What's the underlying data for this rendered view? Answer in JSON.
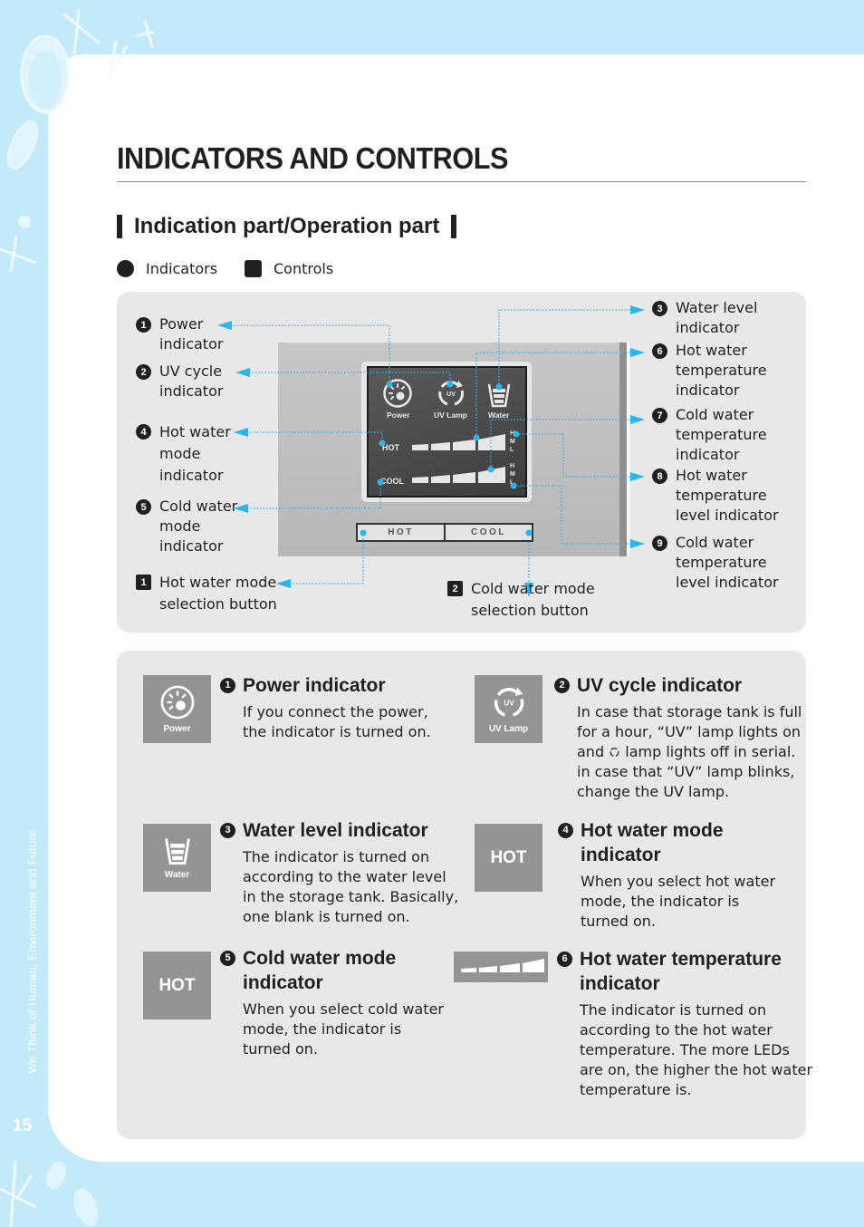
{
  "page": {
    "title": "INDICATORS AND CONTROLS",
    "section_heading": "Indication part/Operation part",
    "side_tagline": "We Think of Human, Environment and Future",
    "page_number": "15"
  },
  "legend": {
    "indicators": "Indicators",
    "controls": "Controls"
  },
  "colors": {
    "background_blue": "#c3eaf9",
    "leader_line": "#29b6ed",
    "panel_gray": "#e8e8e8",
    "thumb_gray": "#949494"
  },
  "diagram": {
    "lcd": {
      "icons": [
        {
          "icon": "power-icon",
          "label": "Power"
        },
        {
          "icon": "uv-cycle-icon",
          "label": "UV Lamp",
          "glyph_text": "UV"
        },
        {
          "icon": "water-cup-icon",
          "label": "Water"
        }
      ],
      "hot_label": "HOT",
      "cool_label": "COOL",
      "level_letters": [
        "H",
        "M",
        "L"
      ]
    },
    "buttons": {
      "hot": "HOT",
      "cool": "COOL"
    },
    "left_callouts": [
      {
        "num": "1",
        "type": "indicator",
        "label": "Power\nindicator"
      },
      {
        "num": "2",
        "type": "indicator",
        "label": "UV cycle\nindicator"
      },
      {
        "num": "4",
        "type": "indicator",
        "label": "Hot water\nmode\nindicator"
      },
      {
        "num": "5",
        "type": "indicator",
        "label": "Cold water\nmode\nindicator"
      },
      {
        "num": "1",
        "type": "control",
        "label": "Hot water mode\nselection button"
      }
    ],
    "bottom_callouts": [
      {
        "num": "2",
        "type": "control",
        "label": "Cold water mode\nselection button"
      }
    ],
    "right_callouts": [
      {
        "num": "3",
        "type": "indicator",
        "label": "Water level\nindicator"
      },
      {
        "num": "6",
        "type": "indicator",
        "label": "Hot water\ntemperature\nindicator"
      },
      {
        "num": "7",
        "type": "indicator",
        "label": "Cold water\ntemperature\nindicator"
      },
      {
        "num": "8",
        "type": "indicator",
        "label": "Hot water\ntemperature\nlevel indicator"
      },
      {
        "num": "9",
        "type": "indicator",
        "label": "Cold water\ntemperature\nlevel indicator"
      }
    ]
  },
  "descriptions": [
    {
      "num": "1",
      "title": "Power indicator",
      "thumb": "power-icon",
      "thumb_caption": "Power",
      "body": "If you connect the power,\nthe indicator is turned on."
    },
    {
      "num": "2",
      "title": "UV cycle indicator",
      "thumb": "uv-cycle-icon",
      "thumb_caption": "UV Lamp",
      "thumb_glyph": "UV",
      "body_parts": [
        "In case that storage tank is full\nfor a hour, “UV” lamp lights on\nand ",
        " lamp lights off in serial.\nin case that “UV” lamp blinks,\nchange the UV lamp."
      ]
    },
    {
      "num": "3",
      "title": "Water level indicator",
      "thumb": "water-cup-icon",
      "thumb_caption": "Water",
      "body": "The indicator is turned on\naccording to the water level\nin the storage tank. Basically,\none blank is turned on."
    },
    {
      "num": "4",
      "title": "Hot water mode\nindicator",
      "thumb": "hot-text",
      "thumb_caption": "HOT",
      "body": "When you select hot water\nmode, the indicator is\nturned on."
    },
    {
      "num": "5",
      "title": "Cold water mode\nindicator",
      "thumb": "hot-text",
      "thumb_caption": "HOT",
      "body": "When you select cold water\nmode, the indicator is\nturned on."
    },
    {
      "num": "6",
      "title": "Hot water temperature\nindicator",
      "thumb": "temperature-bar-icon",
      "body": "The indicator is turned on\naccording to the hot water\ntemperature. The more LEDs\nare on, the higher the hot water\ntemperature is."
    }
  ]
}
